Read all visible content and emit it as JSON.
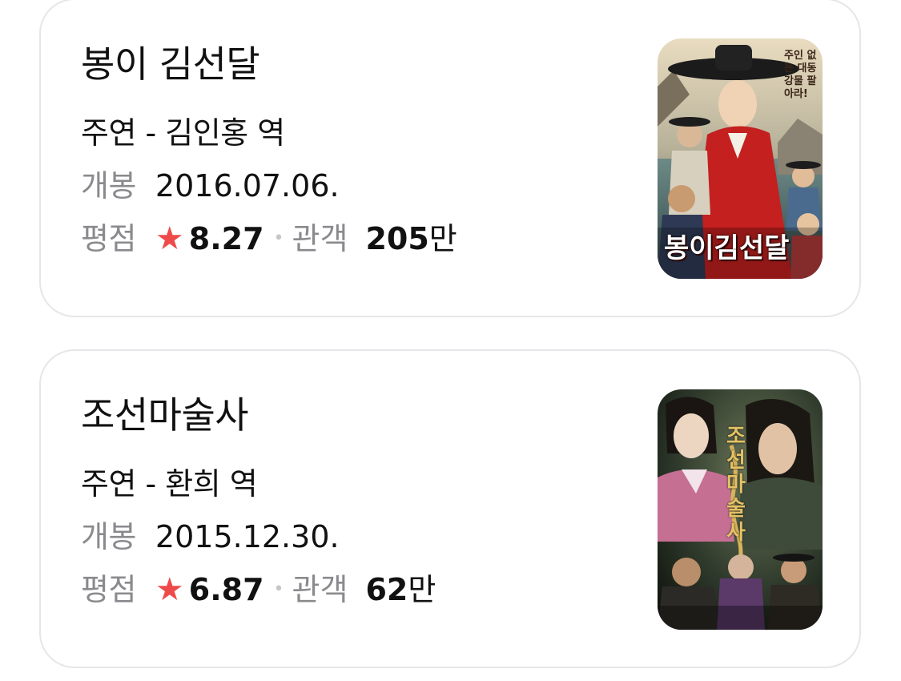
{
  "movies": [
    {
      "title": "봉이 김선달",
      "role": "주연 - 김인홍 역",
      "release_label": "개봉",
      "release_date": "2016.07.06.",
      "rating_label": "평점",
      "rating": "8.27",
      "audience_label": "관객",
      "audience_num": "205",
      "audience_unit": "만",
      "poster": {
        "title": "봉이김선달",
        "tagline": "주인 없는 대동강물 팔아라!"
      }
    },
    {
      "title": "조선마술사",
      "role": "주연 - 환희 역",
      "release_label": "개봉",
      "release_date": "2015.12.30.",
      "rating_label": "평점",
      "rating": "6.87",
      "audience_label": "관객",
      "audience_num": "62",
      "audience_unit": "만",
      "poster": {
        "title": "조선마술사"
      }
    }
  ],
  "icons": {
    "star": "★",
    "separator": "•"
  },
  "colors": {
    "star": "#ef4a4a",
    "label": "#8a8a8e",
    "card_border": "#e6e6ea"
  }
}
